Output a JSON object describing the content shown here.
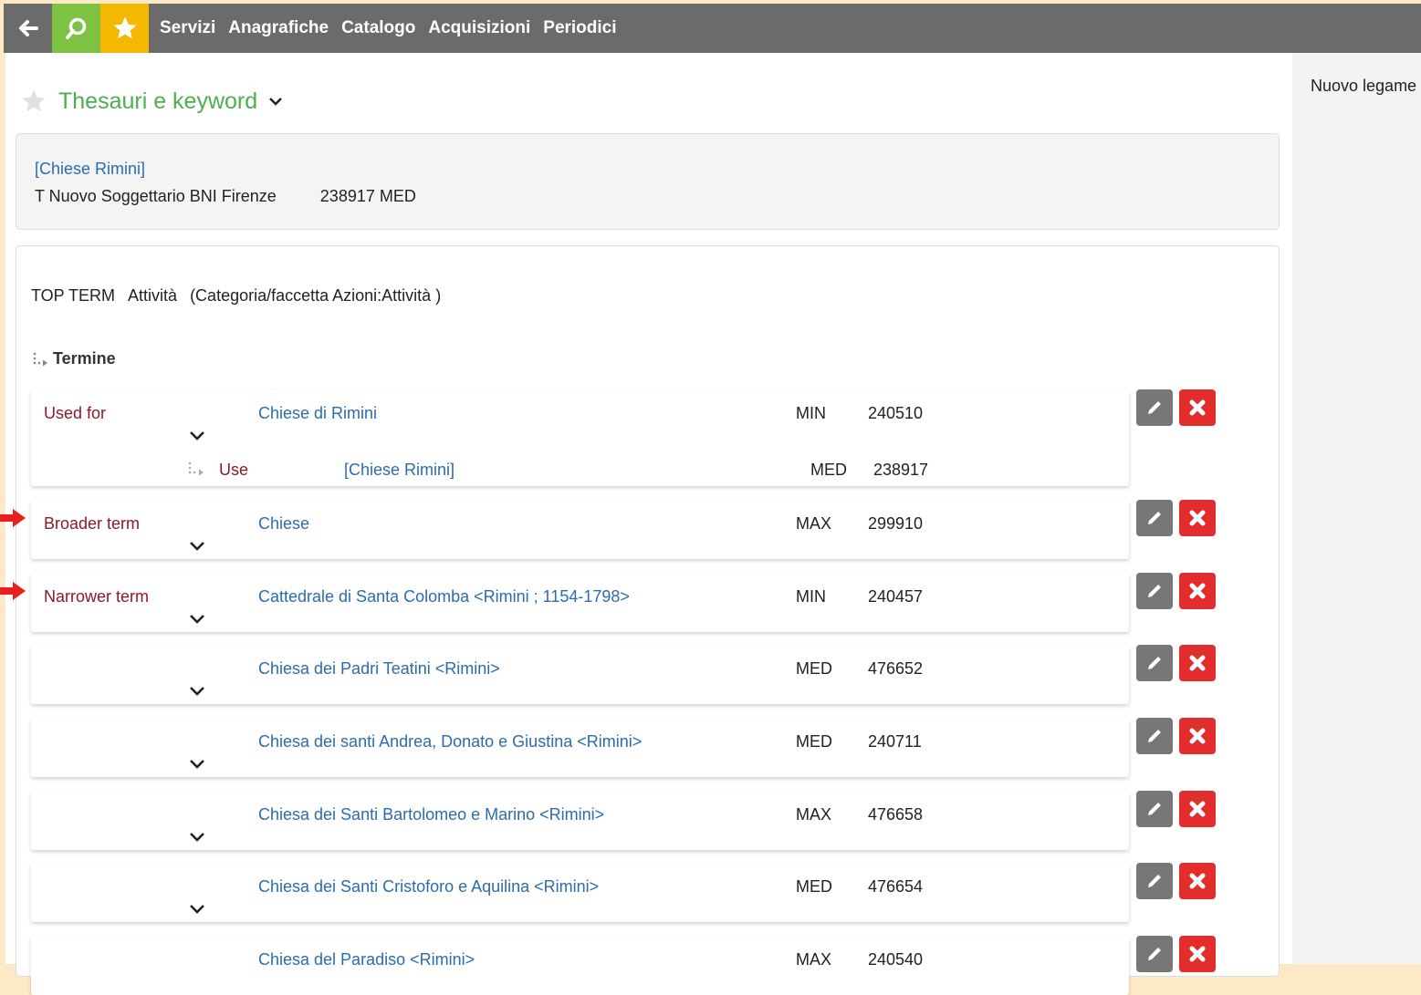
{
  "nav": {
    "menu": [
      "Servizi",
      "Anagrafiche",
      "Catalogo",
      "Acquisizioni",
      "Periodici"
    ]
  },
  "page": {
    "title": "Thesauri e keyword"
  },
  "right_panel": {
    "label": "Nuovo legame"
  },
  "summary": {
    "title": "[Chiese Rimini]",
    "thesaurus": "T Nuovo Soggettario BNI Firenze",
    "code_level": "238917 MED"
  },
  "top_term": {
    "label": "TOP TERM",
    "term": "Attività",
    "category": "(Categoria/faccetta Azioni:Attività )"
  },
  "termine_header": "Termine",
  "rows": [
    {
      "relation": "Used for",
      "term": "Chiese di Rimini",
      "level": "MIN",
      "code": "240510"
    },
    {
      "relation": "Broader term",
      "term": "Chiese",
      "level": "MAX",
      "code": "299910"
    },
    {
      "relation": "Narrower term",
      "term": "Cattedrale di Santa Colomba <Rimini ; 1154-1798>",
      "level": "MIN",
      "code": "240457"
    },
    {
      "relation": "",
      "term": "Chiesa dei Padri Teatini <Rimini>",
      "level": "MED",
      "code": "476652"
    },
    {
      "relation": "",
      "term": "Chiesa dei santi Andrea, Donato e Giustina <Rimini>",
      "level": "MED",
      "code": "240711"
    },
    {
      "relation": "",
      "term": "Chiesa dei Santi Bartolomeo e Marino <Rimini>",
      "level": "MAX",
      "code": "476658"
    },
    {
      "relation": "",
      "term": "Chiesa dei Santi Cristoforo e Aquilina <Rimini>",
      "level": "MED",
      "code": "476654"
    },
    {
      "relation": "",
      "term": "Chiesa del Paradiso <Rimini>",
      "level": "MAX",
      "code": "240540"
    }
  ],
  "used_for_sub": {
    "relation": "Use",
    "term": "[Chiese Rimini]",
    "level": "MED",
    "code": "238917"
  },
  "colors": {
    "topbar": "#6b6b6b",
    "search": "#7dc242",
    "star": "#f5b800",
    "title": "#4caf50",
    "link": "#2b6cb0",
    "relation": "#8b1a2b",
    "delete": "#e32d2d",
    "annotation_arrow": "#e8201e"
  },
  "icons": [
    "back-arrow-icon",
    "search-icon",
    "star-icon",
    "favorite-star-icon",
    "chevron-down-icon",
    "tree-branch-icon",
    "pencil-icon",
    "close-icon",
    "red-arrow-icon"
  ]
}
